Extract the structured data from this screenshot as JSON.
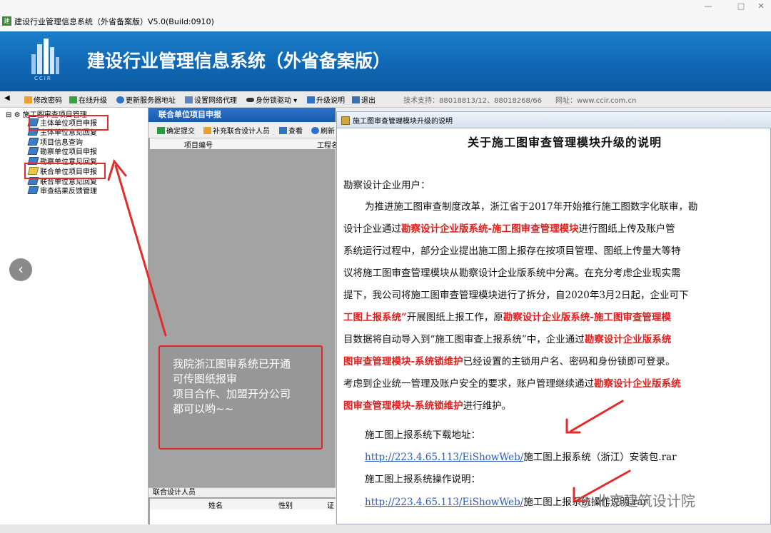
{
  "window": {
    "title": "建设行业管理信息系统（外省备案版）V5.0(Build:0910)",
    "minimize": "—",
    "maximize": "□",
    "close": "✕"
  },
  "banner": {
    "title": "建设行业管理信息系统（外省备案版）",
    "logo_text": "CCIR"
  },
  "toolbar": {
    "items": [
      "修改密码",
      "在线升级",
      "更新服务器地址",
      "设置网络代理",
      "身份锁驱动",
      "升级说明",
      "退出"
    ],
    "support": "技术支持：88018813/12、88018268/66",
    "website": "网址：www.ccir.com.cn"
  },
  "tree": {
    "root": "施工图审查项目管理",
    "items": [
      "主体单位项目申报",
      "主体单位意见回复",
      "项目信息查询",
      "勘察单位项目申报",
      "勘察单位意见回复",
      "联合单位项目申报",
      "联合单位意见回复",
      "审查结果反馈管理"
    ]
  },
  "middle": {
    "header": "联合单位项目申报",
    "toolbar": [
      "确定提交",
      "补充联合设计人员",
      "查看",
      "刷新"
    ],
    "columns": [
      "项目编号",
      "工程名"
    ],
    "sub_header": "联合设计人员",
    "sub_columns": [
      "姓名",
      "性别",
      "证"
    ]
  },
  "callout": {
    "lines": [
      "我院浙江图审系统已开通",
      "可传图纸报审",
      "项目合作、加盟开分公司",
      "都可以哟~~"
    ]
  },
  "doc": {
    "window_title": "施工图审查管理模块升级的说明",
    "title": "关于施工图审查管理模块升级的说明",
    "greeting": "勘察设计企业用户：",
    "p1": [
      [
        {
          "t": "为推进施工图审查制度改革，浙江省于2017年开始推行施工图数字化联审，勘"
        }
      ],
      [
        {
          "t": "设计企业通过"
        },
        {
          "t": "勘察设计企业版系统-施工图审查管理模块",
          "r": 1
        },
        {
          "t": "进行图纸上传及账户管"
        }
      ],
      [
        {
          "t": "系统运行过程中，部分企业提出施工图上报存在按项目管理、图纸上传量大等特"
        }
      ],
      [
        {
          "t": "议将施工图审查管理模块从勘察设计企业版系统中分离。在充分考虑企业现实需"
        }
      ],
      [
        {
          "t": "提下，我公司将施工图审查管理模块进行了拆分，自2020年3月2日起，企业可下"
        }
      ],
      [
        {
          "t": "工图上报系统”",
          "r": 1
        },
        {
          "t": "开展图纸上报工作，原"
        },
        {
          "t": "勘察设计企业版系统-施工图审查管理模",
          "r": 1
        }
      ],
      [
        {
          "t": "目数据将自动导入到“施工图审查上报系统”中，企业通过"
        },
        {
          "t": "勘察设计企业版系统",
          "r": 1
        }
      ],
      [
        {
          "t": "图审查管理模块-系统锁维护",
          "r": 1
        },
        {
          "t": "已经设置的主锁用户名、密码和身份锁即可登录。"
        }
      ],
      [
        {
          "t": "考虑到企业统一管理及账户安全的要求，账户管理继续通过"
        },
        {
          "t": "勘察设计企业版系统",
          "r": 1
        }
      ],
      [
        {
          "t": "图审查管理模块-系统锁维护",
          "r": 1
        },
        {
          "t": "进行维护。"
        }
      ]
    ],
    "download_label": "施工图上报系统下载地址：",
    "download_link": "http://223.4.65.113/EiShowWeb/",
    "download_file": "施工图上报系统（浙江）安装包.rar",
    "manual_label": "施工图上报系统操作说明：",
    "manual_link": "http://223.4.65.113/EiShowWeb/",
    "manual_file": "施工图上报系统操作说明.rar"
  },
  "watermark": "北京建筑设计院"
}
